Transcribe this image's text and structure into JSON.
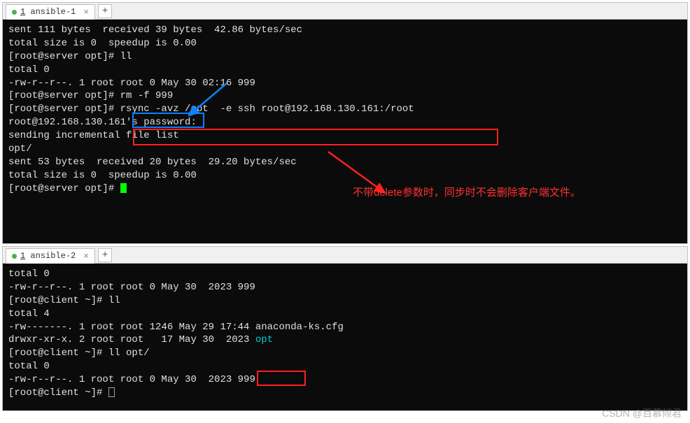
{
  "window1": {
    "tab": {
      "index": "1",
      "name": "ansible-1"
    },
    "lines": {
      "l0": "sent 111 bytes  received 39 bytes  42.86 bytes/sec",
      "l1": "total size is 0  speedup is 0.00",
      "l2": "[root@server opt]# ll",
      "l3": "total 0",
      "l4": "-rw-r--r--. 1 root root 0 May 30 02:16 999",
      "l5": "[root@server opt]# rm -f 999 ",
      "l6": "[root@server opt]# rsync -avz /opt  -e ssh root@192.168.130.161:/root",
      "l7": "root@192.168.130.161's password: ",
      "l8": "sending incremental file list",
      "l9": "opt/",
      "l10": "",
      "l11": "sent 53 bytes  received 20 bytes  29.20 bytes/sec",
      "l12": "total size is 0  speedup is 0.00",
      "l13": "[root@server opt]# "
    }
  },
  "window2": {
    "tab": {
      "index": "1",
      "name": "ansible-2"
    },
    "lines": {
      "l0": "total 0",
      "l1": "-rw-r--r--. 1 root root 0 May 30  2023 999",
      "l2": "[root@client ~]# ll",
      "l3": "total 4",
      "l4": "-rw-------. 1 root root 1246 May 29 17:44 anaconda-ks.cfg",
      "l5a": "drwxr-xr-x. 2 root root   17 May 30  2023 ",
      "l5b": "opt",
      "l6": "[root@client ~]# ll opt/",
      "l7": "total 0",
      "l8": "-rw-r--r--. 1 root root 0 May 30  2023 999",
      "l9": "[root@client ~]# "
    }
  },
  "annotation": "不带delete参数时，同步时不会删除客户端文件。",
  "watermark": "CSDN @百慕倾君"
}
